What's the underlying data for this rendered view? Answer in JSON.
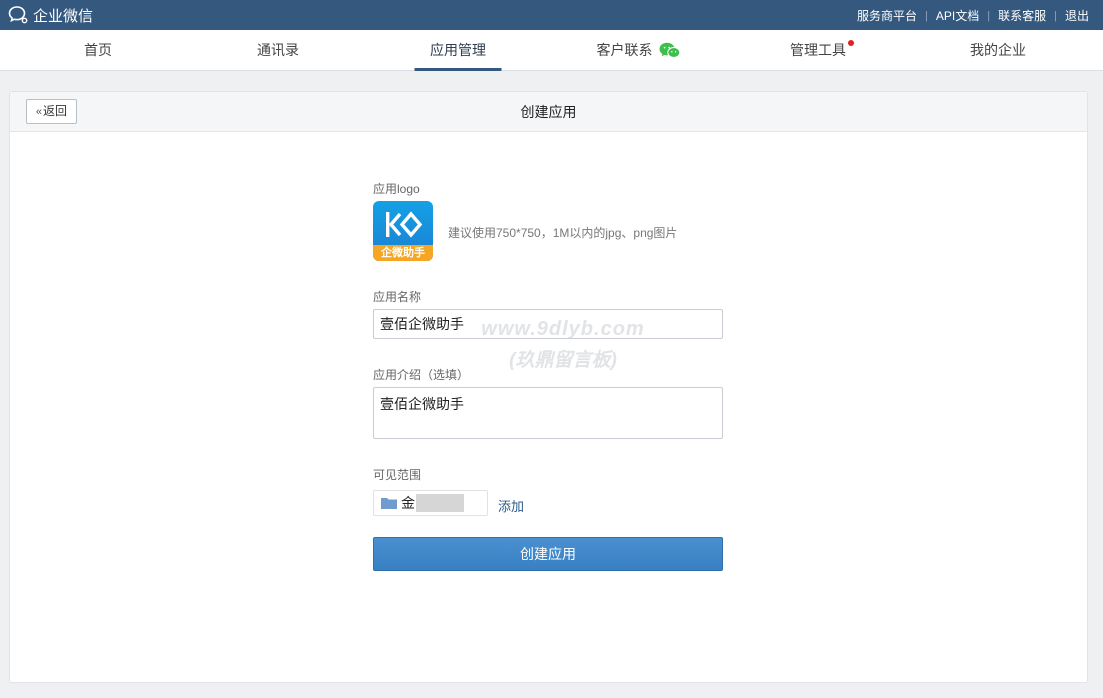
{
  "topbar": {
    "brand": "企业微信",
    "links": [
      "服务商平台",
      "API文档",
      "联系客服",
      "退出"
    ],
    "separator": "|"
  },
  "nav": {
    "items": [
      {
        "label": "首页"
      },
      {
        "label": "通讯录"
      },
      {
        "label": "应用管理",
        "active": true
      },
      {
        "label": "客户联系",
        "icon": "wechat-icon"
      },
      {
        "label": "管理工具",
        "badge": "red-dot"
      },
      {
        "label": "我的企业"
      }
    ]
  },
  "panel": {
    "back_label": "返回",
    "title": "创建应用"
  },
  "form": {
    "logo_label": "应用logo",
    "logo_badge_text": "企微助手",
    "logo_hint": "建议使用750*750，1M以内的jpg、png图片",
    "name_label": "应用名称",
    "name_value": "壹佰企微助手",
    "intro_label": "应用介绍（选填）",
    "intro_value": "壹佰企微助手",
    "scope_label": "可见范围",
    "scope_item": "金",
    "add_label": "添加",
    "submit_label": "创建应用"
  },
  "watermark": {
    "line1": "www.9dlyb.com",
    "line2": "(玖鼎留言板)"
  },
  "colors": {
    "topbar": "#34587e",
    "accent": "#3880c3",
    "badge": "#e0211d",
    "wechat_green": "#3dbf4b"
  }
}
